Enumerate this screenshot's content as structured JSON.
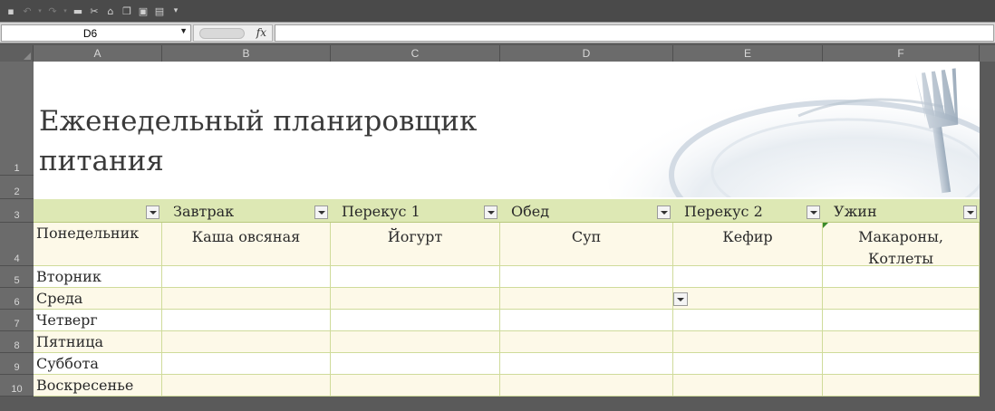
{
  "toolbar": {
    "icons": [
      "save-icon",
      "undo-icon",
      "redo-icon",
      "form-icon",
      "cut-icon",
      "format-painter-icon",
      "copy-icon",
      "paste-icon",
      "print-preview-icon",
      "customize-icon"
    ]
  },
  "formula_bar": {
    "name_box": "D6",
    "fx_label": "fx",
    "formula": ""
  },
  "columns": [
    "A",
    "B",
    "C",
    "D",
    "E",
    "F"
  ],
  "rows": [
    "1",
    "2",
    "3",
    "4",
    "5",
    "6",
    "7",
    "8",
    "9",
    "10"
  ],
  "sheet": {
    "title_line1": "Еженедельный планировщик",
    "title_line2": "питания",
    "headers": [
      "",
      "Завтрак",
      "Перекус 1",
      "Обед",
      "Перекус 2",
      "Ужин"
    ],
    "days": [
      "Понедельник",
      "Вторник",
      "Среда",
      "Четверг",
      "Пятница",
      "Суббота",
      "Воскресенье"
    ],
    "monday": {
      "breakfast": "Каша овсяная",
      "snack1": "Йогурт",
      "lunch": "Суп",
      "snack2": "Кефир",
      "dinner_line1": "Макароны,",
      "dinner_line2": "Котлеты"
    }
  },
  "colors": {
    "header_band": "#dde8b4",
    "row_band": "#fdf9e8",
    "grid_line": "#cfdb9a"
  }
}
